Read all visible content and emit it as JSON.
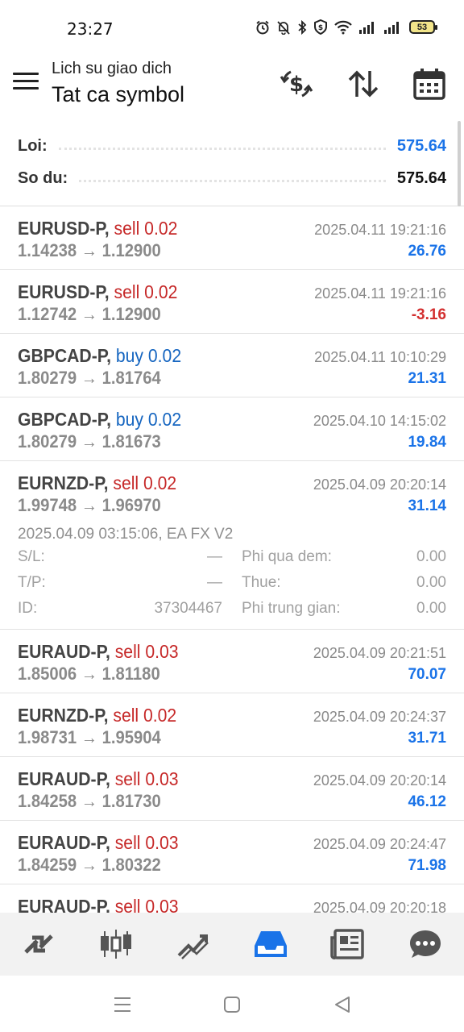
{
  "status_bar": {
    "time": "23:27",
    "battery": "53",
    "icons": [
      "alarm-icon",
      "mute-icon",
      "bluetooth-icon",
      "shield-icon",
      "wifi-icon",
      "signal-icon",
      "signal-icon",
      "battery-icon"
    ]
  },
  "header": {
    "subtitle": "Lich su giao dich",
    "title": "Tat ca symbol",
    "icons": [
      "currency-exchange-icon",
      "sort-icon",
      "calendar-icon"
    ]
  },
  "summary": {
    "profit_label": "Loi:",
    "profit_value": "575.64",
    "balance_label": "So du:",
    "balance_value": "575.64"
  },
  "colors": {
    "sell": "#c62828",
    "buy": "#1565c0",
    "profit_positive": "#1a73e8",
    "profit_negative": "#d32f2f",
    "accent": "#1a73e8"
  },
  "trades": [
    {
      "symbol": "EURUSD-P,",
      "side": "sell",
      "volume": "0.02",
      "prices": "1.14238 → 1.12900",
      "time": "2025.04.11 19:21:16",
      "profit": "26.76"
    },
    {
      "symbol": "EURUSD-P,",
      "side": "sell",
      "volume": "0.02",
      "prices": "1.12742 → 1.12900",
      "time": "2025.04.11 19:21:16",
      "profit": "-3.16"
    },
    {
      "symbol": "GBPCAD-P,",
      "side": "buy",
      "volume": "0.02",
      "prices": "1.80279 → 1.81764",
      "time": "2025.04.11 10:10:29",
      "profit": "21.31"
    },
    {
      "symbol": "GBPCAD-P,",
      "side": "buy",
      "volume": "0.02",
      "prices": "1.80279 → 1.81673",
      "time": "2025.04.10 14:15:02",
      "profit": "19.84"
    },
    {
      "symbol": "EURNZD-P,",
      "side": "sell",
      "volume": "0.02",
      "prices": "1.99748 → 1.96970",
      "time": "2025.04.09 20:20:14",
      "profit": "31.14"
    },
    {
      "symbol": "EURAUD-P,",
      "side": "sell",
      "volume": "0.03",
      "prices": "1.85006 → 1.81180",
      "time": "2025.04.09 20:21:51",
      "profit": "70.07"
    },
    {
      "symbol": "EURNZD-P,",
      "side": "sell",
      "volume": "0.02",
      "prices": "1.98731 → 1.95904",
      "time": "2025.04.09 20:24:37",
      "profit": "31.71"
    },
    {
      "symbol": "EURAUD-P,",
      "side": "sell",
      "volume": "0.03",
      "prices": "1.84258 → 1.81730",
      "time": "2025.04.09 20:20:14",
      "profit": "46.12"
    },
    {
      "symbol": "EURAUD-P,",
      "side": "sell",
      "volume": "0.03",
      "prices": "1.84259 → 1.80322",
      "time": "2025.04.09 20:24:47",
      "profit": "71.98"
    },
    {
      "symbol": "EURAUD-P,",
      "side": "sell",
      "volume": "0.03",
      "prices": "",
      "time": "2025.04.09 20:20:18",
      "profit": ""
    }
  ],
  "expanded_detail": {
    "open_info": "2025.04.09 03:15:06, EA FX V2",
    "sl_label": "S/L:",
    "sl_value": "—",
    "tp_label": "T/P:",
    "tp_value": "—",
    "id_label": "ID:",
    "id_value": "37304467",
    "swap_label": "Phi qua dem:",
    "swap_value": "0.00",
    "tax_label": "Thue:",
    "tax_value": "0.00",
    "commission_label": "Phi trung gian:",
    "commission_value": "0.00"
  },
  "bottom_nav": [
    "quotes-icon",
    "chart-icon",
    "trade-icon",
    "history-icon",
    "news-icon",
    "messages-icon"
  ],
  "system_nav": [
    "recents-icon",
    "home-icon",
    "back-icon"
  ]
}
